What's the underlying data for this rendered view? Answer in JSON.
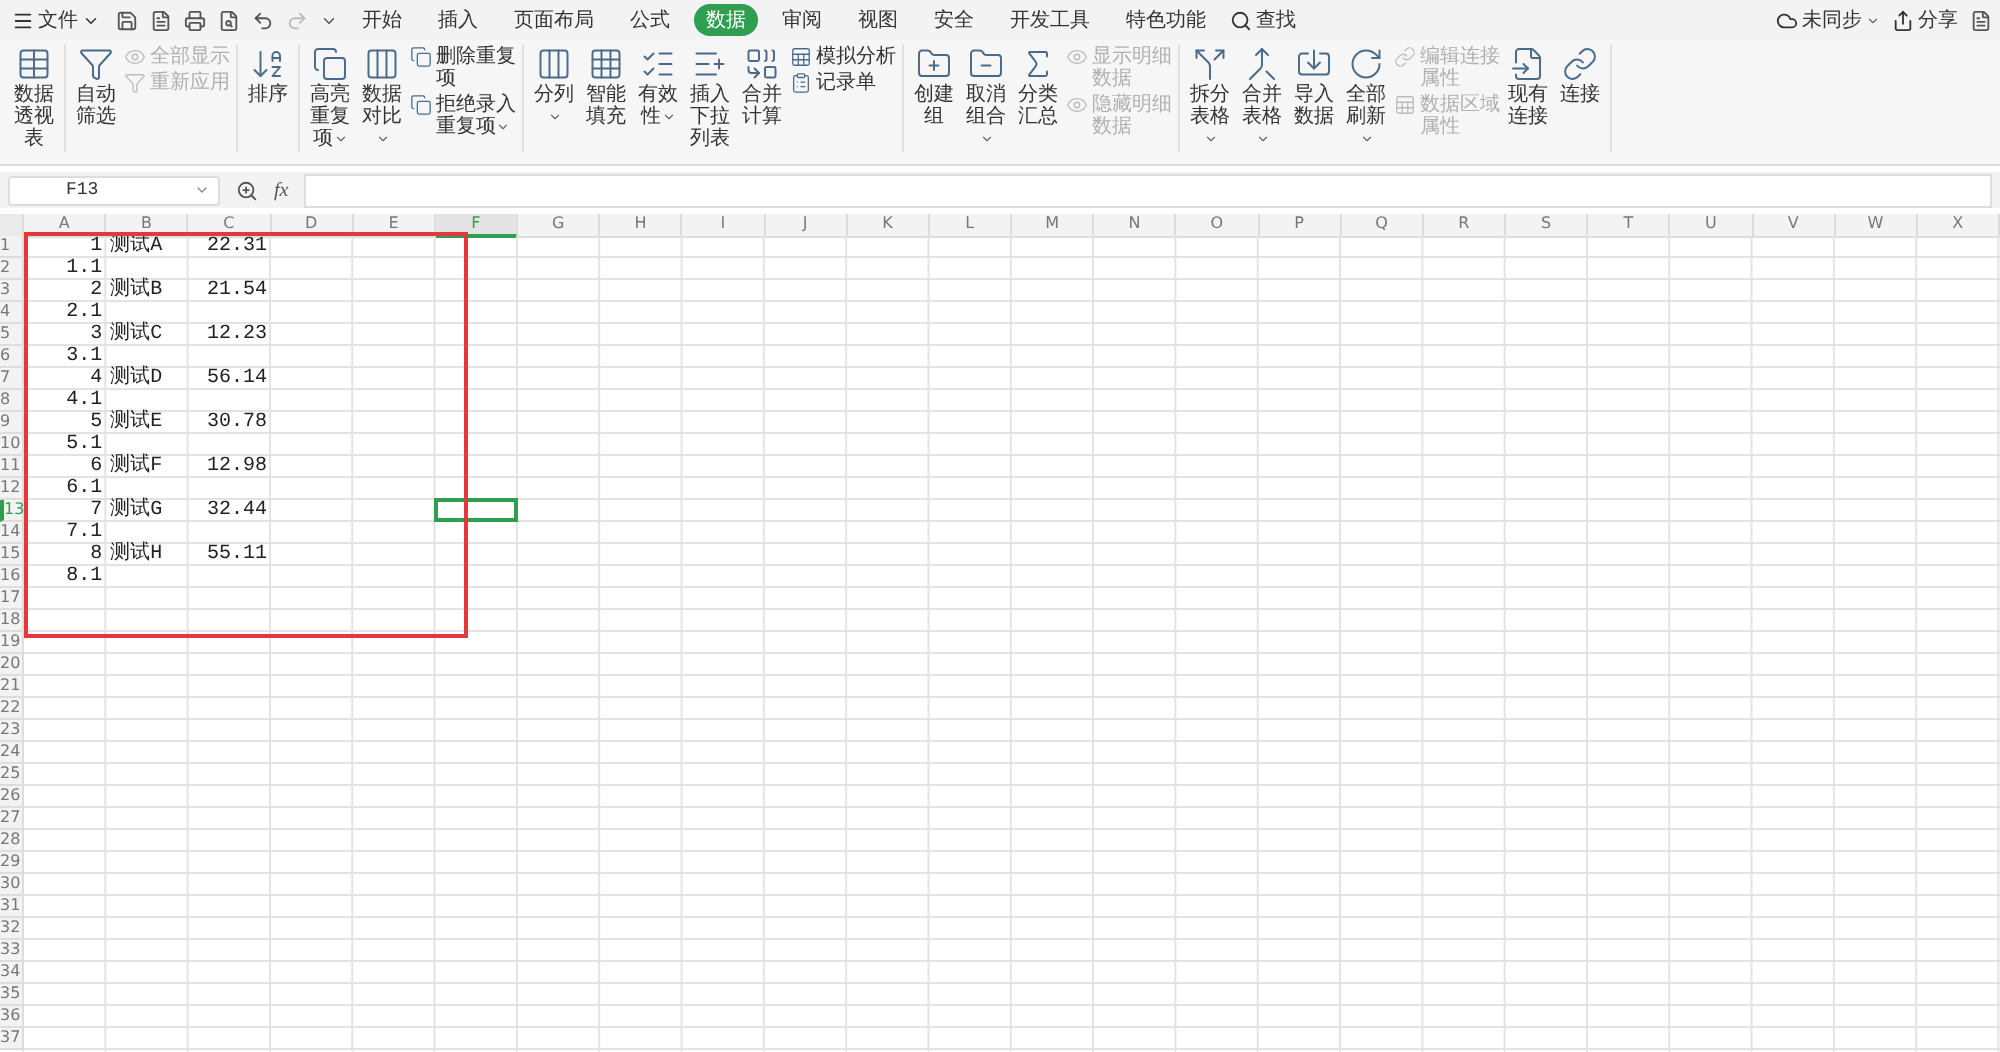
{
  "menu_bar": {
    "file_menu": "文件",
    "tabs": [
      {
        "label": "开始",
        "selected": false
      },
      {
        "label": "插入",
        "selected": false
      },
      {
        "label": "页面布局",
        "selected": false
      },
      {
        "label": "公式",
        "selected": false
      },
      {
        "label": "数据",
        "selected": true
      },
      {
        "label": "审阅",
        "selected": false
      },
      {
        "label": "视图",
        "selected": false
      },
      {
        "label": "安全",
        "selected": false
      },
      {
        "label": "开发工具",
        "selected": false
      },
      {
        "label": "特色功能",
        "selected": false
      }
    ],
    "search": "查找",
    "sync": "未同步",
    "share": "分享"
  },
  "ribbon": {
    "groups": [
      {
        "items": [
          {
            "kind": "large",
            "label": "数据透视表"
          }
        ]
      },
      {
        "items": [
          {
            "kind": "large",
            "label": "自动筛选"
          },
          {
            "kind": "pair",
            "items": [
              {
                "label": "全部显示",
                "disabled": true
              },
              {
                "label": "重新应用",
                "disabled": true
              }
            ]
          }
        ]
      },
      {
        "items": [
          {
            "kind": "large",
            "label": "排序"
          }
        ]
      },
      {
        "items": [
          {
            "kind": "large",
            "label": "高亮重复项",
            "dropdown": true
          },
          {
            "kind": "large",
            "label": "数据对比",
            "dropdown": true
          },
          {
            "kind": "pair",
            "items": [
              {
                "label": "删除重复项",
                "disabled": false
              },
              {
                "label": "拒绝录入重复项",
                "disabled": false,
                "dropdown": true
              }
            ]
          }
        ]
      },
      {
        "items": [
          {
            "kind": "large",
            "label": "分列",
            "dropdown": true
          },
          {
            "kind": "large",
            "label": "智能填充"
          },
          {
            "kind": "large",
            "label": "有效性",
            "dropdown": true
          },
          {
            "kind": "large",
            "label": "插入下拉列表"
          },
          {
            "kind": "large",
            "label": "合并计算"
          },
          {
            "kind": "pair",
            "items": [
              {
                "label": "模拟分析",
                "disabled": false
              },
              {
                "label": "记录单",
                "disabled": false
              }
            ]
          }
        ]
      },
      {
        "items": [
          {
            "kind": "large",
            "label": "创建组"
          },
          {
            "kind": "large",
            "label": "取消组合",
            "dropdown": true
          },
          {
            "kind": "large",
            "label": "分类汇总"
          },
          {
            "kind": "pair",
            "items": [
              {
                "label": "显示明细数据",
                "disabled": true
              },
              {
                "label": "隐藏明细数据",
                "disabled": true
              }
            ]
          }
        ]
      },
      {
        "items": [
          {
            "kind": "large",
            "label": "拆分表格",
            "dropdown": true
          },
          {
            "kind": "large",
            "label": "合并表格",
            "dropdown": true
          },
          {
            "kind": "large",
            "label": "导入数据"
          },
          {
            "kind": "large",
            "label": "全部刷新",
            "dropdown": true
          },
          {
            "kind": "pair",
            "items": [
              {
                "label": "编辑连接属性",
                "disabled": true
              },
              {
                "label": "数据区域属性",
                "disabled": true
              }
            ]
          },
          {
            "kind": "large",
            "label": "现有连接"
          },
          {
            "kind": "large",
            "label": "连接"
          }
        ]
      }
    ]
  },
  "formula_bar": {
    "name_box": "F13",
    "fx_label": "fx"
  },
  "sheet": {
    "highlight_box": true,
    "columns": [
      {
        "label": "A",
        "selected": false
      },
      {
        "label": "B",
        "selected": false
      },
      {
        "label": "C",
        "selected": false
      },
      {
        "label": "D",
        "selected": false
      },
      {
        "label": "E",
        "selected": false
      },
      {
        "label": "F",
        "selected": true
      },
      {
        "label": "G",
        "selected": false
      },
      {
        "label": "H",
        "selected": false
      },
      {
        "label": "I",
        "selected": false
      },
      {
        "label": "J",
        "selected": false
      },
      {
        "label": "K",
        "selected": false
      },
      {
        "label": "L",
        "selected": false
      },
      {
        "label": "M",
        "selected": false
      },
      {
        "label": "N",
        "selected": false
      },
      {
        "label": "O",
        "selected": false
      },
      {
        "label": "P",
        "selected": false
      },
      {
        "label": "Q",
        "selected": false
      },
      {
        "label": "R",
        "selected": false
      },
      {
        "label": "S",
        "selected": false
      },
      {
        "label": "T",
        "selected": false
      },
      {
        "label": "U",
        "selected": false
      },
      {
        "label": "V",
        "selected": false
      },
      {
        "label": "W",
        "selected": false
      },
      {
        "label": "X",
        "selected": false
      }
    ],
    "rows": [
      {
        "number": "1",
        "selected": false,
        "cells": [
          "1",
          "测试A",
          "22.31"
        ]
      },
      {
        "number": "2",
        "selected": false,
        "cells": [
          "1.1"
        ]
      },
      {
        "number": "3",
        "selected": false,
        "cells": [
          "2",
          "测试B",
          "21.54"
        ]
      },
      {
        "number": "4",
        "selected": false,
        "cells": [
          "2.1"
        ]
      },
      {
        "number": "5",
        "selected": false,
        "cells": [
          "3",
          "测试C",
          "12.23"
        ]
      },
      {
        "number": "6",
        "selected": false,
        "cells": [
          "3.1"
        ]
      },
      {
        "number": "7",
        "selected": false,
        "cells": [
          "4",
          "测试D",
          "56.14"
        ]
      },
      {
        "number": "8",
        "selected": false,
        "cells": [
          "4.1"
        ]
      },
      {
        "number": "9",
        "selected": false,
        "cells": [
          "5",
          "测试E",
          "30.78"
        ]
      },
      {
        "number": "10",
        "selected": false,
        "cells": [
          "5.1"
        ]
      },
      {
        "number": "11",
        "selected": false,
        "cells": [
          "6",
          "测试F",
          "12.98"
        ]
      },
      {
        "number": "12",
        "selected": false,
        "cells": [
          "6.1"
        ]
      },
      {
        "number": "13",
        "selected": true,
        "cells": [
          "7",
          "测试G",
          "32.44"
        ]
      },
      {
        "number": "14",
        "selected": false,
        "cells": [
          "7.1"
        ]
      },
      {
        "number": "15",
        "selected": false,
        "cells": [
          "8",
          "测试H",
          "55.11"
        ]
      },
      {
        "number": "16",
        "selected": false,
        "cells": [
          "8.1"
        ]
      },
      {
        "number": "17",
        "selected": false
      },
      {
        "number": "18",
        "selected": false
      },
      {
        "number": "19",
        "selected": false
      },
      {
        "number": "20",
        "selected": false
      },
      {
        "number": "21",
        "selected": false
      },
      {
        "number": "22",
        "selected": false
      },
      {
        "number": "23",
        "selected": false
      },
      {
        "number": "24",
        "selected": false
      },
      {
        "number": "25",
        "selected": false
      },
      {
        "number": "26",
        "selected": false
      },
      {
        "number": "27",
        "selected": false
      },
      {
        "number": "28",
        "selected": false
      },
      {
        "number": "29",
        "selected": false
      },
      {
        "number": "30",
        "selected": false
      },
      {
        "number": "31",
        "selected": false
      },
      {
        "number": "32",
        "selected": false
      },
      {
        "number": "33",
        "selected": false
      },
      {
        "number": "34",
        "selected": false
      },
      {
        "number": "35",
        "selected": false
      },
      {
        "number": "36",
        "selected": false
      },
      {
        "number": "37",
        "selected": false
      }
    ]
  }
}
